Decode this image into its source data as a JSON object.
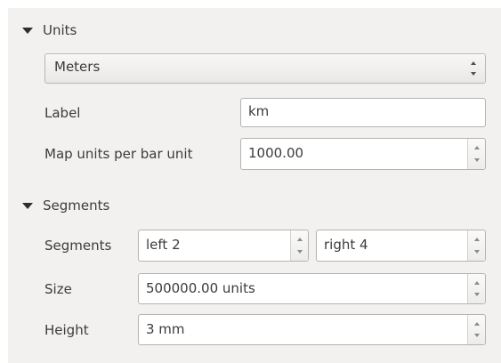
{
  "units_section": {
    "title": "Units",
    "unit_select": {
      "value": "Meters"
    },
    "label_field": {
      "label": "Label",
      "value": "km"
    },
    "map_units_field": {
      "label": "Map units per bar unit",
      "value": "1000.00"
    }
  },
  "segments_section": {
    "title": "Segments",
    "segments_row": {
      "label": "Segments",
      "left_value": "left 2",
      "right_value": "right 4"
    },
    "size_row": {
      "label": "Size",
      "value": "500000.00 units"
    },
    "height_row": {
      "label": "Height",
      "value": "3 mm"
    }
  },
  "icons": {
    "collapse": "triangle-down-icon",
    "spin_up": "chevron-up-icon",
    "spin_down": "chevron-down-icon"
  }
}
